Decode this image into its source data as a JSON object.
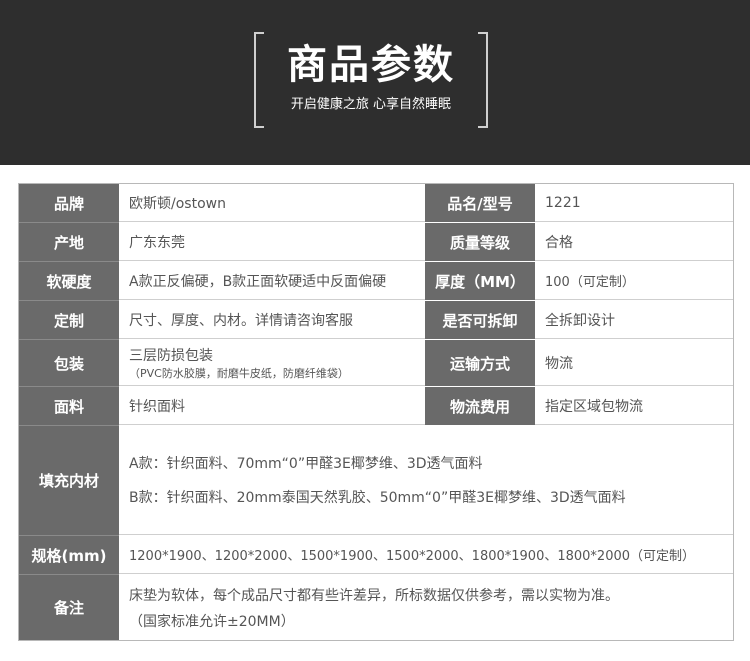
{
  "header": {
    "title": "商品参数",
    "subtitle": "开启健康之旅 心享自然睡眠"
  },
  "params": {
    "brand_label": "品牌",
    "brand_value": "欧斯顿/ostown",
    "model_label": "品名/型号",
    "model_value": "1221",
    "origin_label": "产地",
    "origin_value": "广东东莞",
    "grade_label": "质量等级",
    "grade_value": "合格",
    "hardness_label": "软硬度",
    "hardness_value": "A款正反偏硬，B款正面软硬适中反面偏硬",
    "thickness_label": "厚度（MM）",
    "thickness_value": "100（可定制）",
    "custom_label": "定制",
    "custom_value": "尺寸、厚度、内材。详情请咨询客服",
    "detach_label": "是否可拆卸",
    "detach_value": "全拆卸设计",
    "package_label": "包装",
    "package_value_line1": "三层防损包装",
    "package_value_line2": "（PVC防水胶膜，耐磨牛皮纸，防磨纤维袋）",
    "shipping_label": "运输方式",
    "shipping_value": "物流",
    "fabric_label": "面料",
    "fabric_value": "针织面料",
    "freight_label": "物流费用",
    "freight_value": "指定区域包物流",
    "filling_label": "填充内材",
    "filling_value_a": "A款：针织面料、70mm“0”甲醛3E椰梦维、3D透气面料",
    "filling_value_b": "B款：针织面料、20mm泰国天然乳胶、50mm“0”甲醛3E椰梦维、3D透气面料",
    "size_label": "规格(mm)",
    "size_value": "1200*1900、1200*2000、1500*1900、1500*2000、1800*1900、1800*2000（可定制）",
    "note_label": "备注",
    "note_line1": "床垫为软体，每个成品尺寸都有些许差异，所标数据仅供参考，需以实物为准。",
    "note_line2": "（国家标准允许±20MM）"
  }
}
